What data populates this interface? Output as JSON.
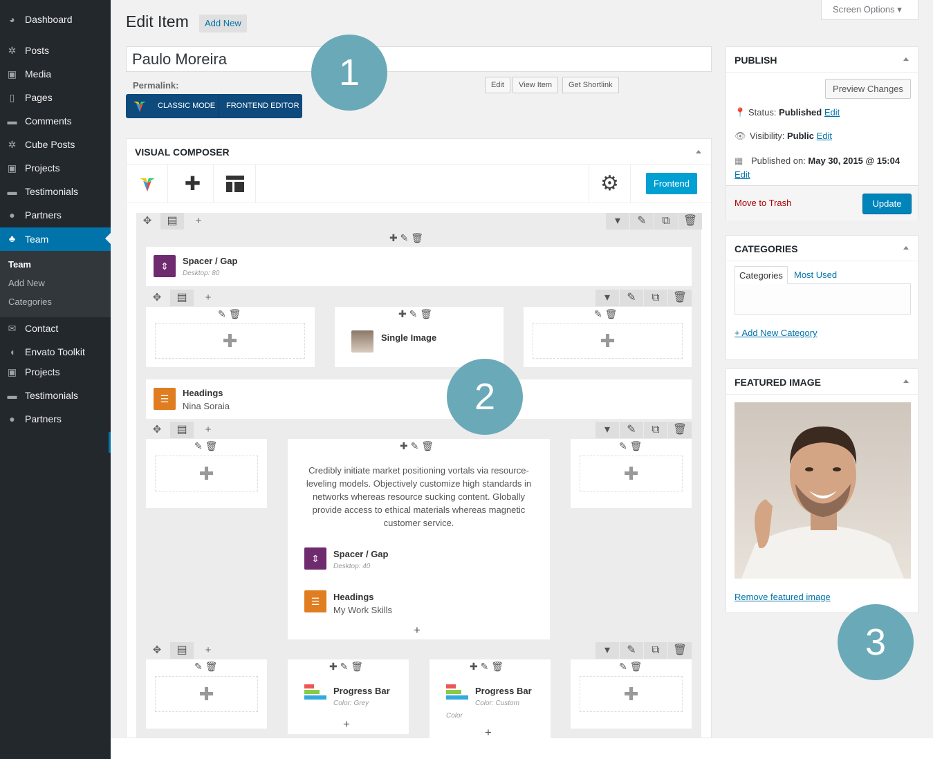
{
  "sidebar": {
    "items": [
      {
        "label": "Dashboard",
        "icon": "dashboard-icon",
        "glyph": "◕"
      },
      {
        "label": "Posts",
        "icon": "pin-icon",
        "glyph": "✲"
      },
      {
        "label": "Media",
        "icon": "media-icon",
        "glyph": "▣"
      },
      {
        "label": "Pages",
        "icon": "pages-icon",
        "glyph": "▯"
      },
      {
        "label": "Comments",
        "icon": "comment-icon",
        "glyph": "▬"
      },
      {
        "label": "Cube Posts",
        "icon": "pin-icon",
        "glyph": "✲"
      },
      {
        "label": "Projects",
        "icon": "image-icon",
        "glyph": "▣"
      },
      {
        "label": "Testimonials",
        "icon": "comments-icon",
        "glyph": "▬"
      },
      {
        "label": "Partners",
        "icon": "user-icon",
        "glyph": "●"
      },
      {
        "label": "Team",
        "icon": "team-icon",
        "glyph": "♣"
      },
      {
        "label": "Contact",
        "icon": "email-icon",
        "glyph": "✉"
      },
      {
        "label": "Envato Toolkit",
        "icon": "leaf-icon",
        "glyph": "◖"
      },
      {
        "label": "Projects",
        "icon": "image-icon",
        "glyph": "▣"
      },
      {
        "label": "Testimonials",
        "icon": "comments-icon",
        "glyph": "▬"
      },
      {
        "label": "Partners",
        "icon": "user-icon",
        "glyph": "●"
      }
    ],
    "submenu": [
      "Team",
      "Add New",
      "Categories"
    ]
  },
  "header": {
    "title": "Edit Item",
    "add_new": "Add New",
    "screen_options": "Screen Options ▾"
  },
  "post": {
    "title": "Paulo Moreira",
    "permalink_label": "Permalink:",
    "buttons": [
      "Edit",
      "View Item",
      "Get Shortlink"
    ],
    "mode_classic": "CLASSIC MODE",
    "mode_frontend": "FRONTEND EDITOR"
  },
  "callouts": [
    "1",
    "2",
    "3"
  ],
  "composer": {
    "title": "VISUAL COMPOSER",
    "frontend_btn": "Frontend",
    "spacer1": {
      "name": "Spacer / Gap",
      "sub": "Desktop: 80"
    },
    "single_image": "Single Image",
    "headings1": {
      "name": "Headings",
      "sub": "Nina Soraia"
    },
    "text_block": "Credibly initiate market positioning vortals via resource-leveling models. Objectively customize high standards in networks whereas resource sucking content. Globally provide access to ethical materials whereas magnetic customer service.",
    "spacer2": {
      "name": "Spacer / Gap",
      "sub": "Desktop: 40"
    },
    "headings2": {
      "name": "Headings",
      "sub": "My Work Skills"
    },
    "progress1": {
      "name": "Progress Bar",
      "sub": "Color: Grey"
    },
    "progress2": {
      "name": "Progress Bar",
      "sub": "Color: Custom",
      "sub2": "Color"
    }
  },
  "publish": {
    "title": "PUBLISH",
    "preview": "Preview Changes",
    "status_label": "Status:",
    "status_value": "Published",
    "visibility_label": "Visibility:",
    "visibility_value": "Public",
    "published_label": "Published on:",
    "published_value": "May 30, 2015 @ 15:04",
    "edit": "Edit",
    "trash": "Move to Trash",
    "update": "Update"
  },
  "categories": {
    "title": "CATEGORIES",
    "tab_all": "Categories",
    "tab_used": "Most Used",
    "add_new": "+ Add New Category"
  },
  "featured": {
    "title": "FEATURED IMAGE",
    "remove": "Remove featured image"
  },
  "colors": {
    "sidebar_bg": "#23282d",
    "accent": "#0073aa",
    "callout": "#6aaab8",
    "vc_mode_bg": "#0e4a7c",
    "frontend_btn": "#00a0d2",
    "update_btn": "#0085ba"
  }
}
